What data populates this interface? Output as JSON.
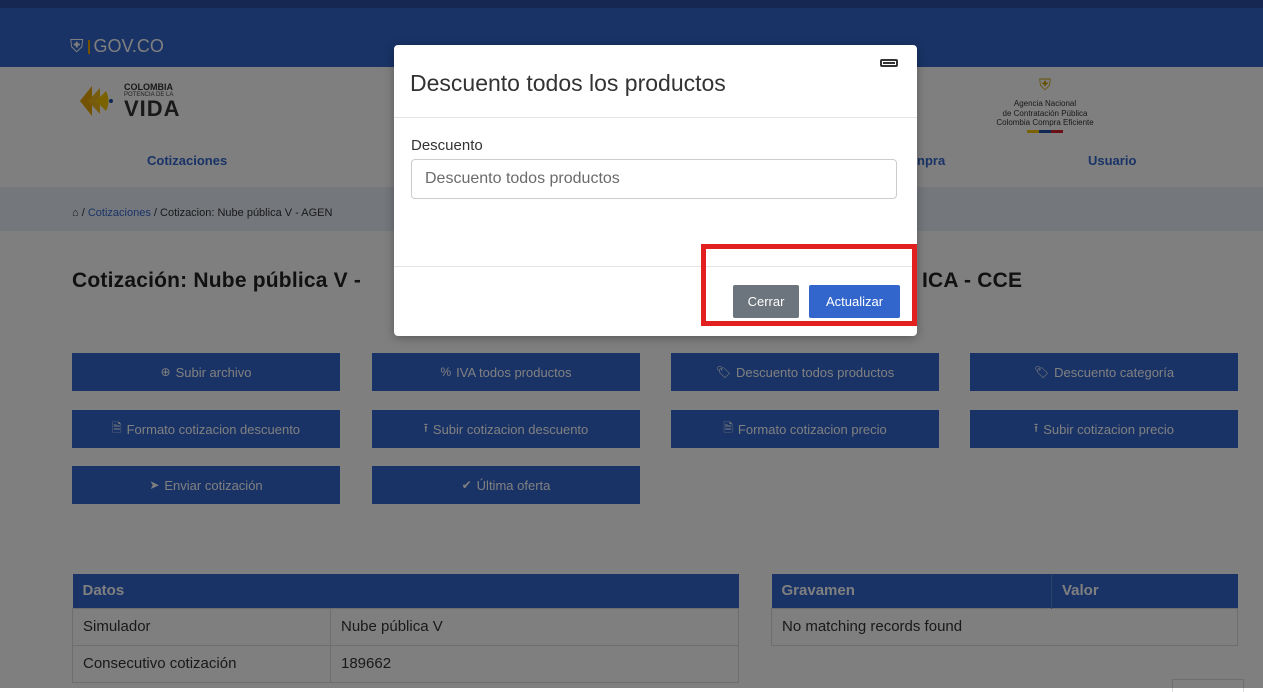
{
  "gov_bar": {
    "logo_text": "GOV.CO"
  },
  "brand": {
    "line1": "COLOMBIA",
    "line2": "POTENCIA DE LA",
    "line3": "VIDA"
  },
  "agency": {
    "line1": "Agencia Nacional",
    "line2": "de Contratación Pública",
    "line3": "Colombia Compra Eficiente"
  },
  "nav": {
    "quotes": "Cotizaciones",
    "partial": "npra",
    "user": "Usuario"
  },
  "breadcrumb": {
    "home_sep": "/",
    "link": "Cotizaciones",
    "rest": "/ Cotizacion: Nube pública V - AGEN"
  },
  "page": {
    "title_left": "Cotización: Nube pública V -",
    "title_right": "ICA - CCE"
  },
  "actions": [
    {
      "label": "Subir archivo",
      "icon": "⊕"
    },
    {
      "label": "IVA todos productos",
      "icon": "%"
    },
    {
      "label": "Descuento todos productos",
      "icon": "🏷"
    },
    {
      "label": "Descuento categoría",
      "icon": "🏷"
    },
    {
      "label": "Formato cotizacion descuento",
      "icon": "🗎"
    },
    {
      "label": "Subir cotizacion descuento",
      "icon": "⭱"
    },
    {
      "label": "Formato cotizacion precio",
      "icon": "🗎"
    },
    {
      "label": "Subir cotizacion precio",
      "icon": "⭱"
    },
    {
      "label": "Enviar cotización",
      "icon": "➤"
    },
    {
      "label": "Última oferta",
      "icon": "✔"
    }
  ],
  "datos_table": {
    "header": "Datos",
    "rows": [
      {
        "key": "Simulador",
        "value": "Nube pública V"
      },
      {
        "key": "Consecutivo cotización",
        "value": "189662"
      }
    ]
  },
  "gravamen_table": {
    "headers": [
      "Gravamen",
      "Valor"
    ],
    "empty_text": "No matching records found"
  },
  "modal": {
    "title": "Descuento todos los productos",
    "field_label": "Descuento",
    "field_placeholder": "Descuento todos productos",
    "field_value": "",
    "close_label": "Cerrar",
    "update_label": "Actualizar"
  },
  "colors": {
    "primary": "#3366cc",
    "secondary": "#6c757d",
    "highlight": "#e32020"
  }
}
